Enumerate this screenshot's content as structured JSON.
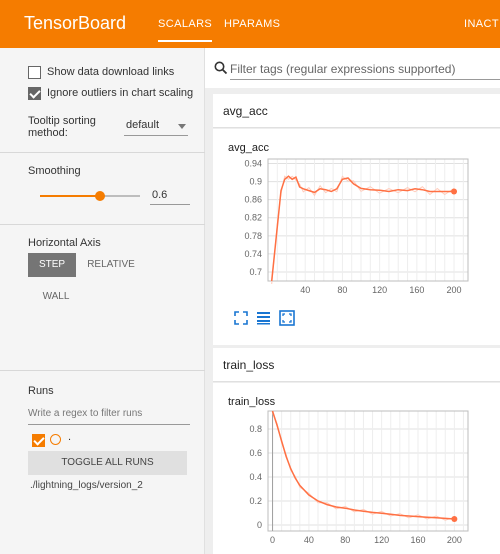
{
  "header": {
    "title": "TensorBoard",
    "tabs": [
      {
        "label": "SCALARS",
        "active": true
      },
      {
        "label": "HPARAMS",
        "active": false
      }
    ],
    "status": "INACTI"
  },
  "sidebar": {
    "show_download_label": "Show data download links",
    "show_download_checked": false,
    "ignore_outliers_label": "Ignore outliers in chart scaling",
    "ignore_outliers_checked": true,
    "tooltip_sorting_label": "Tooltip sorting method:",
    "tooltip_sorting_value": "default",
    "smoothing_label": "Smoothing",
    "smoothing_value": "0.6",
    "horizontal_axis_label": "Horizontal Axis",
    "axis_options": [
      "STEP",
      "RELATIVE",
      "WALL"
    ],
    "axis_selected": "STEP",
    "runs_label": "Runs",
    "runs_filter_placeholder": "Write a regex to filter runs",
    "run_dot_label": ".",
    "toggle_all_label": "TOGGLE ALL RUNS",
    "run_path": "./lightning_logs/version_2"
  },
  "main": {
    "filter_placeholder": "Filter tags (regular expressions supported)",
    "cards": [
      {
        "group_title": "avg_acc",
        "chart_title": "avg_acc"
      },
      {
        "group_title": "train_loss",
        "chart_title": "train_loss"
      }
    ]
  },
  "colors": {
    "accent": "#f57c00",
    "series": "#ff7043",
    "series_raw": "#ffccbc"
  },
  "chart_data": [
    {
      "type": "line",
      "title": "avg_acc",
      "x_ticks": [
        40,
        80,
        120,
        160,
        200
      ],
      "y_ticks": [
        0.7,
        0.74,
        0.78,
        0.82,
        0.86,
        0.9,
        0.94
      ],
      "xlim": [
        0,
        215
      ],
      "ylim": [
        0.68,
        0.95
      ],
      "series": [
        {
          "values": [
            [
              4,
              0.68
            ],
            [
              10,
              0.8
            ],
            [
              14,
              0.88
            ],
            [
              18,
              0.905
            ],
            [
              22,
              0.912
            ],
            [
              26,
              0.905
            ],
            [
              30,
              0.91
            ],
            [
              34,
              0.888
            ],
            [
              38,
              0.884
            ],
            [
              44,
              0.88
            ],
            [
              50,
              0.876
            ],
            [
              56,
              0.884
            ],
            [
              62,
              0.882
            ],
            [
              68,
              0.878
            ],
            [
              74,
              0.884
            ],
            [
              80,
              0.905
            ],
            [
              86,
              0.908
            ],
            [
              92,
              0.895
            ],
            [
              100,
              0.885
            ],
            [
              110,
              0.882
            ],
            [
              120,
              0.881
            ],
            [
              130,
              0.878
            ],
            [
              140,
              0.882
            ],
            [
              150,
              0.88
            ],
            [
              158,
              0.884
            ],
            [
              166,
              0.882
            ],
            [
              174,
              0.878
            ],
            [
              182,
              0.878
            ],
            [
              190,
              0.878
            ],
            [
              200,
              0.878
            ]
          ]
        }
      ]
    },
    {
      "type": "line",
      "title": "train_loss",
      "x_ticks": [
        0,
        40,
        80,
        120,
        160,
        200
      ],
      "y_ticks": [
        0,
        0.2,
        0.4,
        0.6,
        0.8
      ],
      "xlim": [
        -5,
        215
      ],
      "ylim": [
        -0.05,
        0.95
      ],
      "series": [
        {
          "values": [
            [
              0,
              0.95
            ],
            [
              5,
              0.83
            ],
            [
              10,
              0.7
            ],
            [
              15,
              0.57
            ],
            [
              20,
              0.47
            ],
            [
              25,
              0.39
            ],
            [
              30,
              0.33
            ],
            [
              40,
              0.25
            ],
            [
              50,
              0.2
            ],
            [
              60,
              0.17
            ],
            [
              70,
              0.15
            ],
            [
              80,
              0.14
            ],
            [
              90,
              0.125
            ],
            [
              100,
              0.115
            ],
            [
              110,
              0.105
            ],
            [
              120,
              0.098
            ],
            [
              130,
              0.09
            ],
            [
              140,
              0.08
            ],
            [
              150,
              0.075
            ],
            [
              160,
              0.07
            ],
            [
              170,
              0.065
            ],
            [
              180,
              0.06
            ],
            [
              190,
              0.055
            ],
            [
              200,
              0.05
            ]
          ]
        }
      ]
    }
  ]
}
